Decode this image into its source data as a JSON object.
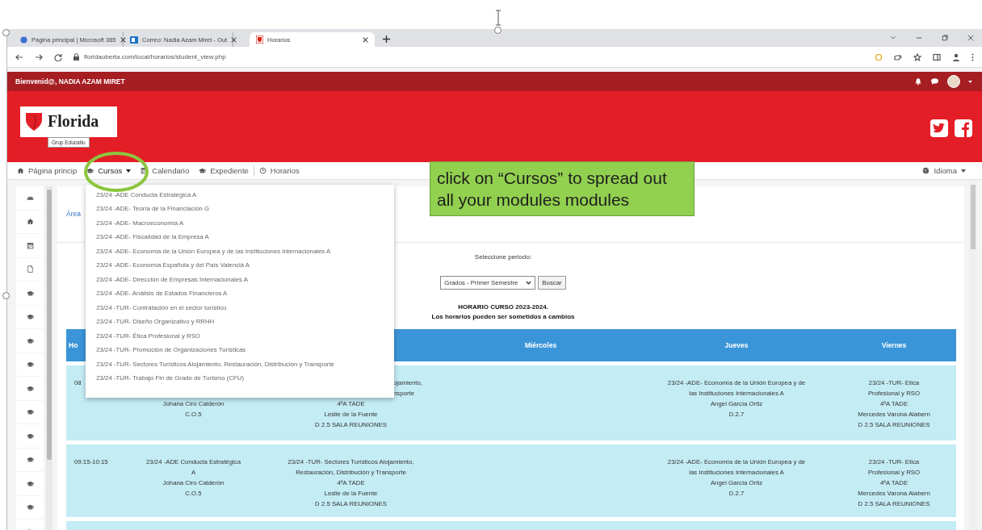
{
  "browser": {
    "tabs": [
      {
        "title": "Página principal | Microsoft 365",
        "kind": "m365",
        "selected": false
      },
      {
        "title": "Correo: Nadia Azam Miret - Out",
        "kind": "mail",
        "selected": false
      },
      {
        "title": "Horarios",
        "kind": "site",
        "selected": true
      }
    ],
    "url": "floridaoberta.com/local/horarios/student_view.php"
  },
  "topbar": {
    "greeting": "Bienvenid@, NADIA AZAM MIRET"
  },
  "header": {
    "logo_name": "Florida",
    "logo_subtitle": "Grup Educatiu",
    "social": [
      {
        "kind": "twitter"
      },
      {
        "kind": "facebook"
      }
    ]
  },
  "nav": {
    "items": [
      {
        "label": "Página princip",
        "kind": "home"
      },
      {
        "label": "Cursos",
        "kind": "courses",
        "expanded": true,
        "menu": [
          "23/24 -ADE Conducta Estratégica A",
          "23/24 -ADE- Teoría de la Financiación G",
          "23/24 -ADE- Macroeconomía A",
          "23/24 -ADE- Fiscalidad de la Empresa A",
          "23/24 -ADE- Economía de la Unión Europea y de las Instituciones Internacionales A",
          "23/24 -ADE- Economía Española y del País Valencià  A",
          "23/24 -ADE- Dirección de Empresas Internacionales A",
          "23/24 -ADE- Análisis de Estados Financieros A",
          "23/24 -TUR- Contratación en el sector turístico",
          "23/24 -TUR- Diseño Organizativo y RRHH",
          "23/24 -TUR- Ética Profesional y RSO",
          "23/24 -TUR- Promoción de Organizaciones Turísticas",
          "23/24 -TUR- Sectores Turísticos Alojamiento, Restauración, Distribución y Transporte",
          "23/24 -TUR- Trabajo Fin de Grado de Turismo (CFU)"
        ]
      },
      {
        "label": "Calendario",
        "kind": "calendar"
      },
      {
        "label": "Expediente",
        "kind": "record"
      },
      {
        "label": "Horarios",
        "kind": "schedule"
      }
    ],
    "language": {
      "label": "Idioma"
    }
  },
  "sidebar": {
    "items": [
      {
        "kind": "dashboard"
      },
      {
        "kind": "home"
      },
      {
        "kind": "calendar"
      },
      {
        "kind": "file"
      },
      {
        "kind": "cap"
      },
      {
        "kind": "cap"
      },
      {
        "kind": "cap"
      },
      {
        "kind": "cap"
      },
      {
        "kind": "cap"
      },
      {
        "kind": "cap"
      },
      {
        "kind": "cap"
      },
      {
        "kind": "cap"
      },
      {
        "kind": "cap"
      },
      {
        "kind": "cap"
      },
      {
        "kind": "expand"
      }
    ]
  },
  "area_card": {
    "text": "Área"
  },
  "schedule": {
    "period_label": "Seleccione periodo:",
    "period_value": "Grados - Primer Semestre",
    "search_button": "Buscar",
    "title": "HORARIO CURSO 2023-2024.",
    "notice": "Los horarios pueden ser sometidos a cambios",
    "columns": [
      "Ho",
      "",
      "",
      "Miércoles",
      "Jueves",
      "Viernes"
    ],
    "rows": [
      {
        "cells": [
          {
            "kind": "time",
            "lines": [
              "08"
            ]
          },
          {
            "kind": "partly_covered",
            "lines": [
              "Johana Ciro Calderón",
              "C.O.5"
            ]
          },
          {
            "kind": "partly_covered",
            "cut_lines": [
              "ojamiento,",
              "nsporte"
            ],
            "lines": [
              "4ºA TADE",
              "Leslie de la Fuente",
              "D 2.5 SALA REUNIONES"
            ]
          },
          {
            "kind": "full"
          },
          {
            "kind": "full",
            "lines": [
              "23/24 -ADE- Economía de la Unión Europea y de",
              "las Instituciones Internacionales A",
              "Angel García Ortiz",
              "D.2.7"
            ]
          },
          {
            "kind": "full",
            "lines": [
              "23/24 -TUR- Etica",
              "Profesional y RSO",
              "4ºA TADE",
              "Mercedes Varona Alabern",
              "D 2.5 SALA REUNIONES"
            ]
          }
        ]
      },
      {
        "cells": [
          {
            "kind": "time",
            "lines": [
              "09:15-10:15"
            ]
          },
          {
            "kind": "full",
            "lines": [
              "23/24 -ADE Conducta Estratégica",
              "A",
              "Johana Ciro Calderón",
              "C.O.5"
            ]
          },
          {
            "kind": "full",
            "lines": [
              "23/24 -TUR- Sectores Turísticos Alojamiento,",
              "Restauración, Distribución y Transporte",
              "4ºA TADE",
              "Leslie de la Fuente",
              "D 2.5 SALA REUNIONES"
            ]
          },
          {
            "kind": "full"
          },
          {
            "kind": "full",
            "lines": [
              "23/24 -ADE- Economía de la Unión Europea y de",
              "las Instituciones Internacionales A",
              "Angel García Ortiz",
              "D.2.7"
            ]
          },
          {
            "kind": "full",
            "lines": [
              "23/24 -TUR- Etica",
              "Profesional y RSO",
              "4ºA TADE",
              "Mercedes Varona Alabern",
              "D 2.5 SALA REUNIONES"
            ]
          }
        ]
      }
    ]
  },
  "annotation": {
    "text": "click on “Cursos” to spread out all your modules modules"
  }
}
